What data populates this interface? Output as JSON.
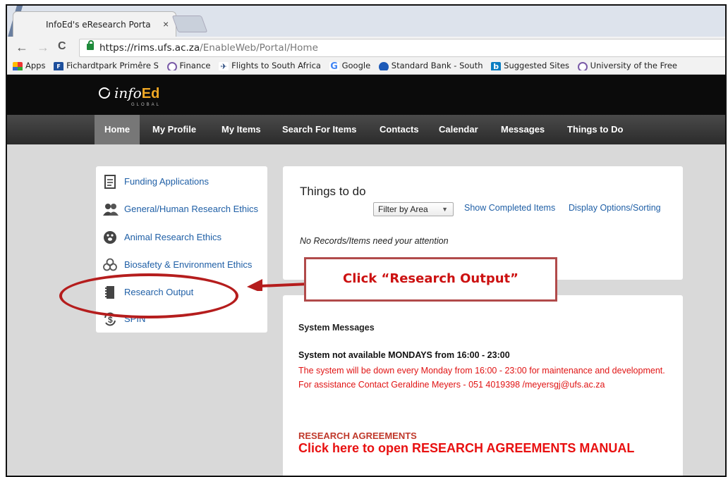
{
  "browser": {
    "tab_title": "InfoEd's eResearch Porta",
    "tab_close": "×",
    "url_main": "https://rims.ufs.ac.za",
    "url_path": "/EnableWeb/Portal/Home",
    "nav_back": "←",
    "nav_forward": "→",
    "nav_reload": "C",
    "bookmarks": [
      {
        "label": "Apps",
        "icon": "apps-grid-icon"
      },
      {
        "label": "Fichardtpark Primêre S",
        "icon": "school-icon"
      },
      {
        "label": "Finance",
        "icon": "shield-icon"
      },
      {
        "label": "Flights to South Africa",
        "icon": "plane-icon"
      },
      {
        "label": "Google",
        "icon": "google-icon"
      },
      {
        "label": "Standard Bank - South",
        "icon": "bank-icon"
      },
      {
        "label": "Suggested Sites",
        "icon": "bing-icon"
      },
      {
        "label": "University of the Free",
        "icon": "shield-icon"
      }
    ]
  },
  "header": {
    "brand": "info",
    "brand_ed": "Ed",
    "brand_sub": "GLOBAL"
  },
  "menu": [
    "Home",
    "My Profile",
    "My Items",
    "Search For Items",
    "Contacts",
    "Calendar",
    "Messages",
    "Things to Do"
  ],
  "sidebar": {
    "items": [
      {
        "label": "Funding Applications",
        "icon": "document-icon"
      },
      {
        "label": "General/Human Research Ethics",
        "icon": "people-icon"
      },
      {
        "label": "Animal Research Ethics",
        "icon": "paw-icon"
      },
      {
        "label": "Biosafety & Environment Ethics",
        "icon": "biohazard-icon"
      },
      {
        "label": "Research Output",
        "icon": "notebook-icon"
      },
      {
        "label": "SPIN",
        "icon": "money-cycle-icon"
      }
    ]
  },
  "todo": {
    "title": "Things to do",
    "filter": "Filter by Area",
    "show_completed": "Show Completed Items",
    "display_options": "Display Options/Sorting",
    "empty": "No Records/Items need your attention"
  },
  "messages": {
    "heading": "System Messages",
    "title": "System not available MONDAYS from 16:00 - 23:00",
    "body": "The system will be down every Monday from 16:00 - 23:00 for maintenance and development. For assistance Contact Geraldine Meyers - 051 4019398 /meyersgj@ufs.ac.za",
    "ra_heading": "RESEARCH AGREEMENTS",
    "ra_link": "Click here to open RESEARCH AGREEMENTS MANUAL"
  },
  "annotation": {
    "callout": "Click “Research Output”"
  },
  "colors": {
    "link": "#1f5fa6",
    "alert": "#e01414",
    "annotation": "#b51d1d"
  }
}
